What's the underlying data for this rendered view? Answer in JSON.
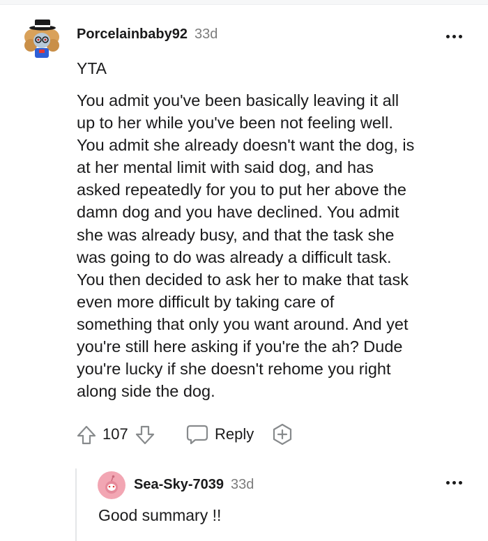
{
  "comment": {
    "author": "Porcelainbaby92",
    "age": "33d",
    "verdict": "YTA",
    "body_lines": [
      "You admit you've been basically leaving it all",
      "up to her while you've been not feeling well.",
      "You admit she already doesn't want the dog, is",
      "at her mental limit with said dog, and has",
      "asked repeatedly for you to put her above the",
      "damn dog and you have declined. You admit",
      "she was already busy, and that the task she",
      "was going to do was already a difficult task.",
      "You then decided to ask her to make that task",
      "even more difficult by taking care of",
      "something that only you want around. And yet",
      "you're still here asking if you're the ah? Dude",
      "you're lucky if she doesn't rehome you right",
      "along side the dog."
    ],
    "actions": {
      "score": "107",
      "reply_label": "Reply",
      "upvote_icon": "upvote-arrow-icon",
      "downvote_icon": "downvote-arrow-icon",
      "reply_icon": "speech-bubble-icon",
      "award_icon": "plus-badge-icon"
    },
    "more_icon": "three-dots-icon"
  },
  "reply": {
    "author": "Sea-Sky-7039",
    "age": "33d",
    "body": "Good summary !!",
    "more_icon": "three-dots-icon"
  },
  "colors": {
    "text": "#1a1a1b",
    "meta": "#7c7c7c",
    "icon": "#878a8c",
    "thread_line": "#e4e6e8",
    "reply_avatar": "#f2a6b3"
  }
}
